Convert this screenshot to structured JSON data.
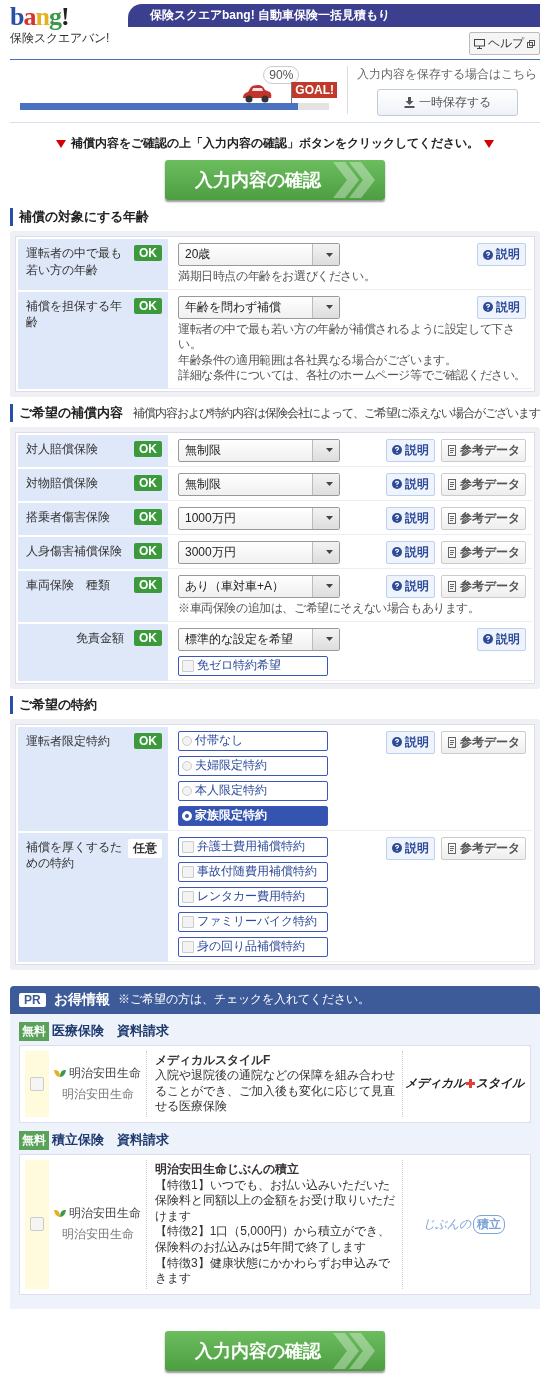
{
  "header": {
    "logo": "bang!",
    "logo_sub": "保険スクエアバン!",
    "title": "保険スクエアbang! 自動車保険一括見積もり",
    "help_button": "ヘルプ"
  },
  "progress": {
    "level": 0.9,
    "percent": "90%",
    "goal": "GOAL!",
    "save_hint": "入力内容を保存する場合はこちら",
    "save_button": "一時保存する"
  },
  "instruction": "補償内容をご確認の上「入力内容の確認」ボタンをクリックしてください。",
  "confirm_button": "入力内容の確認",
  "sections": [
    {
      "title": "補償の対象にする年齢",
      "rows": [
        {
          "label": "運転者の中で最も若い方の年齢",
          "badge": {
            "text": "OK",
            "kind": "ok"
          },
          "kind": "select",
          "sub": false,
          "value": "20歳",
          "hints": [
            "満期日時点の年齢をお選びください。"
          ],
          "buttons": [
            {
              "text": "説明",
              "kind": "help"
            }
          ]
        },
        {
          "label": "補償を担保する年齢",
          "badge": {
            "text": "OK",
            "kind": "ok"
          },
          "kind": "select",
          "sub": false,
          "value": "年齢を問わず補償",
          "hints": [
            "運転者の中で最も若い方の年齢が補償されるように設定して下さい。",
            "年齢条件の適用範囲は各社異なる場合がございます。",
            "詳細な条件については、各社のホームページ等でご確認ください。"
          ],
          "buttons": [
            {
              "text": "説明",
              "kind": "help"
            }
          ]
        }
      ]
    },
    {
      "title": "ご希望の補償内容",
      "note": "補償内容および特約内容は保険会社によって、ご希望に添えない場合がございます",
      "rows": [
        {
          "label": "対人賠償保険",
          "badge": {
            "text": "OK",
            "kind": "ok"
          },
          "kind": "select",
          "sub": false,
          "value": "無制限",
          "buttons": [
            {
              "text": "説明",
              "kind": "help"
            },
            {
              "text": "参考データ",
              "kind": "data"
            }
          ]
        },
        {
          "label": "対物賠償保険",
          "badge": {
            "text": "OK",
            "kind": "ok"
          },
          "kind": "select",
          "sub": false,
          "value": "無制限",
          "buttons": [
            {
              "text": "説明",
              "kind": "help"
            },
            {
              "text": "参考データ",
              "kind": "data"
            }
          ]
        },
        {
          "label": "搭乗者傷害保険",
          "badge": {
            "text": "OK",
            "kind": "ok"
          },
          "kind": "select",
          "sub": false,
          "value": "1000万円",
          "buttons": [
            {
              "text": "説明",
              "kind": "help"
            },
            {
              "text": "参考データ",
              "kind": "data"
            }
          ]
        },
        {
          "label": "人身傷害補償保険",
          "badge": {
            "text": "OK",
            "kind": "ok"
          },
          "kind": "select",
          "sub": false,
          "value": "3000万円",
          "buttons": [
            {
              "text": "説明",
              "kind": "help"
            },
            {
              "text": "参考データ",
              "kind": "data"
            }
          ]
        },
        {
          "label": "車両保険　種類",
          "badge": {
            "text": "OK",
            "kind": "ok"
          },
          "kind": "select",
          "sub": false,
          "value": "あり（車対車+A）",
          "hints": [
            "※車両保険の追加は、ご希望にそえない場合もあります。"
          ],
          "buttons": [
            {
              "text": "説明",
              "kind": "help"
            },
            {
              "text": "参考データ",
              "kind": "data"
            }
          ]
        },
        {
          "label": "免責金額",
          "badge": {
            "text": "OK",
            "kind": "ok"
          },
          "kind": "select",
          "sub": true,
          "value": "標準的な設定を希望",
          "options": [
            {
              "text": "免ゼロ特約希望",
              "checked": false
            }
          ],
          "buttons": [
            {
              "text": "説明",
              "kind": "help"
            }
          ]
        }
      ]
    },
    {
      "title": "ご希望の特約",
      "rows": [
        {
          "label": "運転者限定特約",
          "badge": {
            "text": "OK",
            "kind": "ok"
          },
          "kind": "radio",
          "sub": false,
          "options": [
            {
              "text": "付帯なし",
              "selected": false
            },
            {
              "text": "夫婦限定特約",
              "selected": false
            },
            {
              "text": "本人限定特約",
              "selected": false
            },
            {
              "text": "家族限定特約",
              "selected": true
            }
          ],
          "buttons": [
            {
              "text": "説明",
              "kind": "help"
            },
            {
              "text": "参考データ",
              "kind": "data"
            }
          ]
        },
        {
          "label": "補償を厚くするための特約",
          "badge": {
            "text": "任意",
            "kind": "optional"
          },
          "kind": "checkbox",
          "sub": false,
          "options": [
            {
              "text": "弁護士費用補償特約",
              "checked": false
            },
            {
              "text": "事故付随費用補償特約",
              "checked": false
            },
            {
              "text": "レンタカー費用特約",
              "checked": false
            },
            {
              "text": "ファミリーバイク特約",
              "checked": false
            },
            {
              "text": "身の回り品補償特約",
              "checked": false
            }
          ],
          "buttons": [
            {
              "text": "説明",
              "kind": "help"
            },
            {
              "text": "参考データ",
              "kind": "data"
            }
          ]
        }
      ]
    }
  ],
  "promo": {
    "badge": "PR",
    "title": "お得情報",
    "note": "※ご希望の方は、チェックを入れてください。",
    "items": [
      {
        "tag": "無料",
        "heading": "医療保険　資料請求",
        "checked": false,
        "company": "明治安田生命",
        "company_sub": "明治安田生命",
        "product": "メディカルスタイルF",
        "description": [
          "入院や退院後の通院などの保障を組み合わせることができ、ご加入後も変化に応じて見直せる医療保険"
        ],
        "kind": "cross",
        "logo_parts": [
          "メディカル",
          "スタイル"
        ]
      },
      {
        "tag": "無料",
        "heading": "積立保険　資料請求",
        "checked": false,
        "company": "明治安田生命",
        "company_sub": "明治安田生命",
        "product": "明治安田生命じぶんの積立",
        "description": [
          "【特徴1】いつでも、お払い込みいただいた保険料と同額以上の金額をお受け取りいただけます",
          "【特徴2】1口（5,000円）から積立ができ、保険料のお払込みは5年間で終了します",
          "【特徴3】健康状態にかかわらずお申込みできます"
        ],
        "kind": "bubble",
        "logo_parts": [
          "じぶんの",
          "積立"
        ]
      }
    ]
  },
  "bottom_button": "入力内容の確認"
}
